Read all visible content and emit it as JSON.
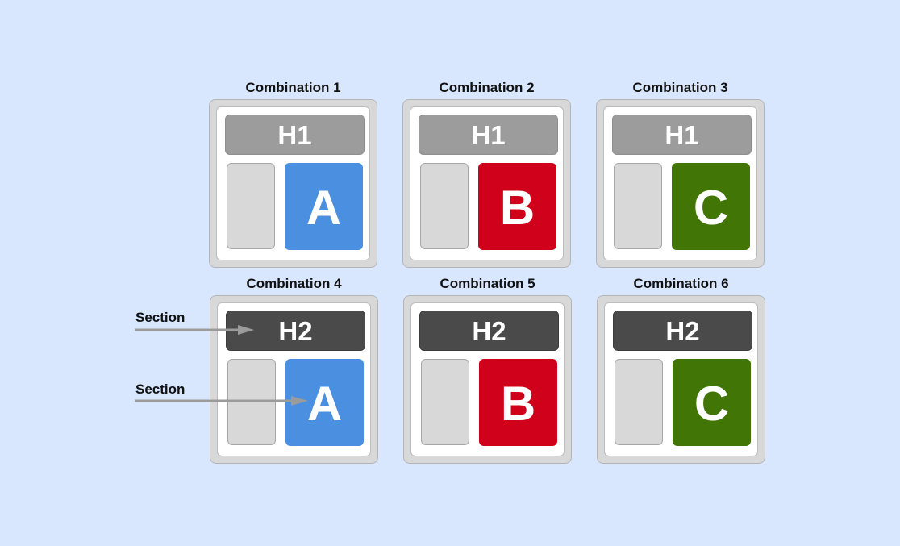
{
  "colors": {
    "background": "#d8e7fd",
    "A": "#4a8fe0",
    "B": "#d0021b",
    "C": "#417505",
    "H1": "#9c9c9c",
    "H2": "#4a4a4a",
    "arrow": "#9b9b9b"
  },
  "combinations": [
    {
      "title": "Combination 1",
      "header": "H1",
      "content": "A"
    },
    {
      "title": "Combination 2",
      "header": "H1",
      "content": "B"
    },
    {
      "title": "Combination 3",
      "header": "H1",
      "content": "C"
    },
    {
      "title": "Combination 4",
      "header": "H2",
      "content": "A"
    },
    {
      "title": "Combination 5",
      "header": "H2",
      "content": "B"
    },
    {
      "title": "Combination 6",
      "header": "H2",
      "content": "C"
    }
  ],
  "annotations": [
    {
      "label": "Section",
      "points_to": "H2 header of Combination 4"
    },
    {
      "label": "Section",
      "points_to": "A content of Combination 4"
    }
  ]
}
